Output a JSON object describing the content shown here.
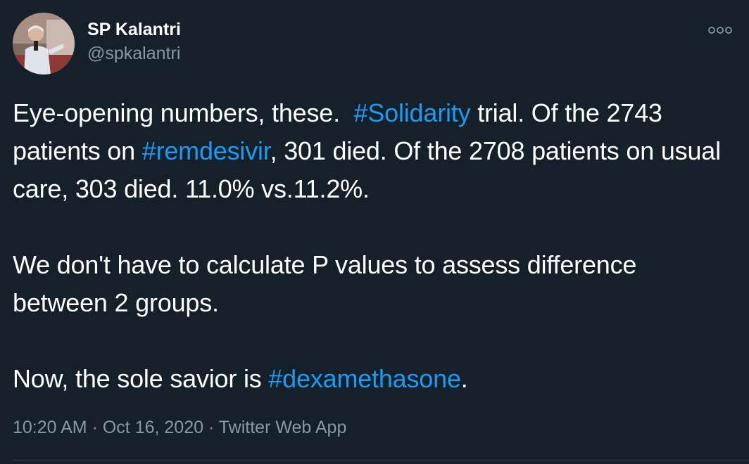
{
  "author": {
    "name": "SP Kalantri",
    "handle": "@spkalantri"
  },
  "tweet": {
    "p1_a": "Eye-opening numbers, these.  ",
    "p1_tag1": "#Solidarity",
    "p1_b": " trial. Of the 2743 patients on ",
    "p1_tag2": "#remdesivir",
    "p1_c": ", 301 died. Of the 2708 patients on usual care, 303 died. 11.0% vs.11.2%.",
    "p2": "We don't have to calculate P values to assess difference between 2 groups.",
    "p3_a": "Now, the sole savior is ",
    "p3_tag": "#dexamethasone",
    "p3_b": "."
  },
  "meta": {
    "time": "10:20 AM",
    "separator1": " · ",
    "date": "Oct 16, 2020",
    "separator2": " · ",
    "source": "Twitter Web App"
  },
  "icons": {
    "more": "more-horizontal-icon"
  },
  "colors": {
    "background": "#15202b",
    "text": "#ffffff",
    "secondary_text": "#8899a6",
    "hashtag": "#1d9bf0",
    "divider": "#38444d"
  }
}
